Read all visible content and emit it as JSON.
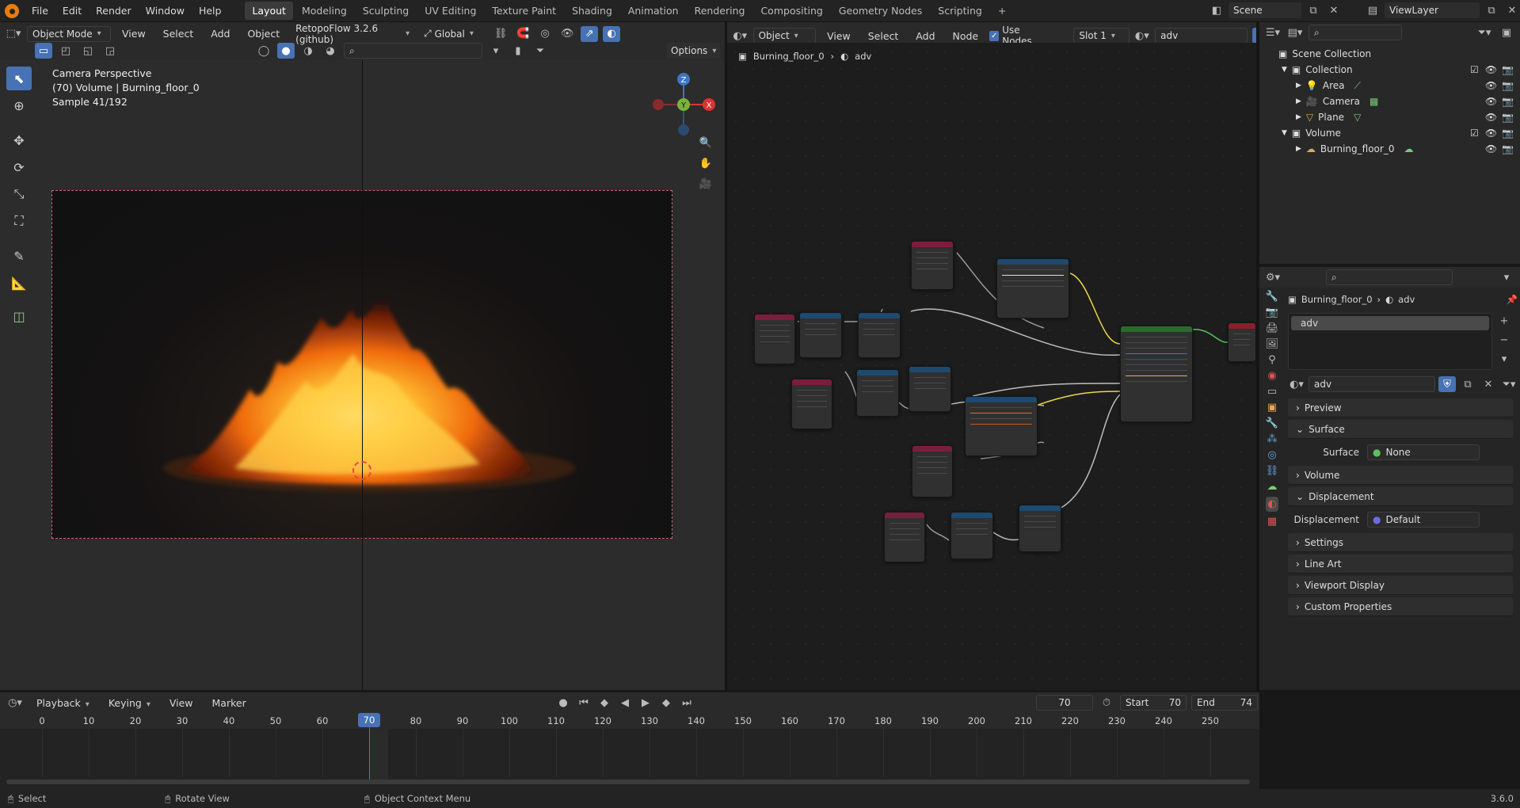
{
  "menubar": {
    "items": [
      "File",
      "Edit",
      "Render",
      "Window",
      "Help"
    ],
    "workspaces": [
      "Layout",
      "Modeling",
      "Sculpting",
      "UV Editing",
      "Texture Paint",
      "Shading",
      "Animation",
      "Rendering",
      "Compositing",
      "Geometry Nodes",
      "Scripting"
    ],
    "active_workspace": "Layout",
    "add_tab": "+",
    "scene": "Scene",
    "view_layer": "ViewLayer"
  },
  "viewport": {
    "mode": "Object Mode",
    "menus": [
      "View",
      "Select",
      "Add",
      "Object"
    ],
    "addon": "RetopoFlow 3.2.6 (github)",
    "orientation": "Global",
    "options": "Options",
    "overlay_lines": [
      "Camera Perspective",
      "(70) Volume | Burning_floor_0",
      "Sample 41/192"
    ],
    "gizmo": {
      "z": "Z",
      "y": "Y",
      "x": "X"
    }
  },
  "node_editor": {
    "type": "Object",
    "menus": [
      "View",
      "Select",
      "Add",
      "Node"
    ],
    "use_nodes": "Use Nodes",
    "slot": "Slot 1",
    "material": "adv",
    "breadcrumb": {
      "object": "Burning_floor_0",
      "material": "adv"
    }
  },
  "outliner": {
    "search_placeholder": "",
    "rows": [
      {
        "label": "Scene Collection",
        "depth": 0
      },
      {
        "label": "Collection",
        "depth": 1
      },
      {
        "label": "Area",
        "depth": 2
      },
      {
        "label": "Camera",
        "depth": 2
      },
      {
        "label": "Plane",
        "depth": 2
      },
      {
        "label": "Volume",
        "depth": 1
      },
      {
        "label": "Burning_floor_0",
        "depth": 2
      }
    ]
  },
  "properties": {
    "breadcrumb": {
      "object": "Burning_floor_0",
      "material": "adv"
    },
    "slot_item": "adv",
    "material_name": "adv",
    "panels": [
      "Preview",
      "Surface",
      "Volume",
      "Displacement",
      "Settings",
      "Line Art",
      "Viewport Display",
      "Custom Properties"
    ],
    "surface": {
      "label": "Surface",
      "value": "None"
    },
    "displacement": {
      "label": "Displacement",
      "value": "Default"
    }
  },
  "timeline": {
    "menus": [
      "Playback",
      "Keying",
      "View",
      "Marker"
    ],
    "current_frame": "70",
    "start_label": "Start",
    "start": "70",
    "end_label": "End",
    "end": "74",
    "ticks": [
      "0",
      "10",
      "20",
      "30",
      "40",
      "50",
      "60",
      "70",
      "80",
      "90",
      "100",
      "110",
      "120",
      "130",
      "140",
      "150",
      "160",
      "170",
      "180",
      "190",
      "200",
      "210",
      "220",
      "230",
      "240",
      "250"
    ]
  },
  "statusbar": {
    "select": "Select",
    "rotate": "Rotate View",
    "context": "Object Context Menu",
    "version": "3.6.0"
  },
  "colors": {
    "accent": "#4772b3",
    "attribute_node": "#7b1e3e",
    "math_node": "#1d4a6e",
    "volume_node": "#2a6b2a",
    "output_node": "#8a1e2a"
  }
}
